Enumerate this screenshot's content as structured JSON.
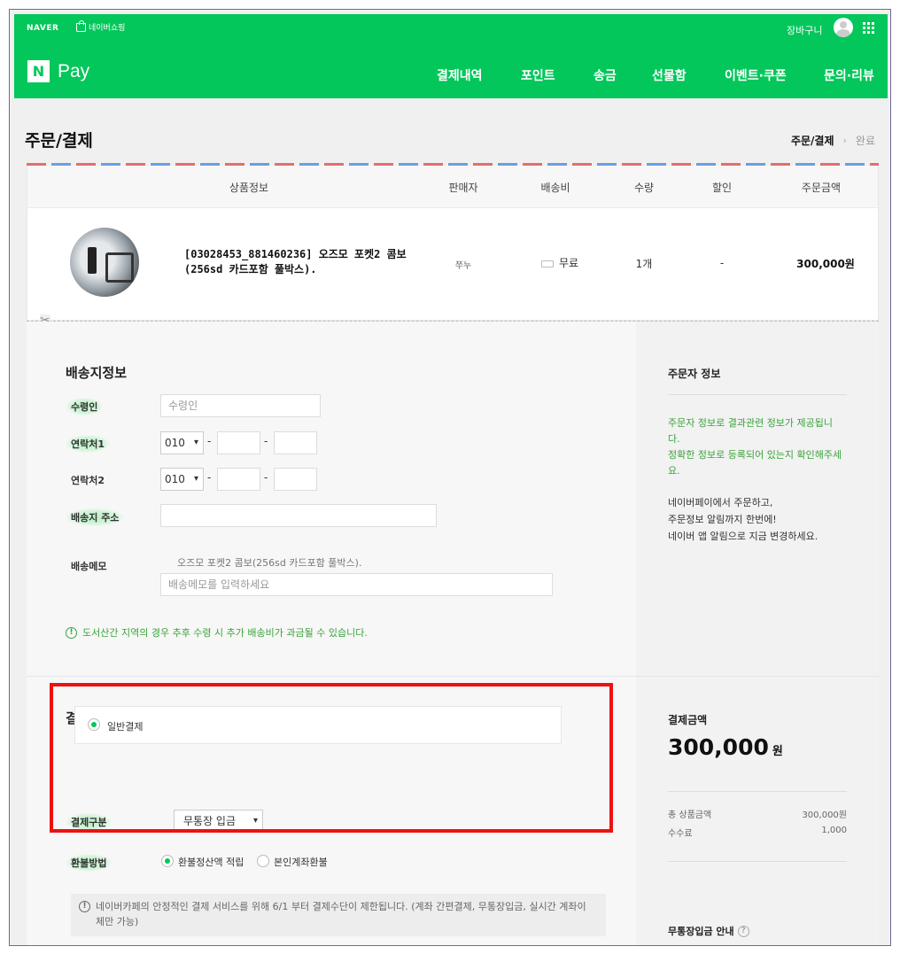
{
  "header": {
    "naver_logo": "NAVER",
    "shopping_link": "네이버쇼핑",
    "cart_link": "장바구니",
    "pay_n": "N",
    "pay_text": "Pay",
    "menu": [
      "결제내역",
      "포인트",
      "송금",
      "선물함",
      "이벤트·쿠폰",
      "문의·리뷰"
    ]
  },
  "page": {
    "title": "주문/결제",
    "step_current": "주문/결제",
    "step_arrow": "›",
    "step_next": "완료"
  },
  "order_table": {
    "columns": [
      "상품정보",
      "판매자",
      "배송비",
      "수량",
      "할인",
      "주문금액"
    ],
    "row": {
      "product_line1": "[03028453_881460236] 오즈모 포켓2 콤보",
      "product_line2": "(256sd 카드포함 풀박스).",
      "seller": "쭈누",
      "shipping": "무료",
      "quantity": "1개",
      "discount": "-",
      "amount": "300,000원"
    }
  },
  "delivery": {
    "title": "배송지정보",
    "recipient_label": "수령인",
    "recipient_placeholder": "수령인",
    "phone1_label": "연락처1",
    "phone2_label": "연락처2",
    "phone_prefix": "010",
    "dash": "-",
    "address_label": "배송지 주소",
    "memo_label": "배송메모",
    "memo_product": "오즈모 포켓2 콤보(256sd 카드포함 풀박스).",
    "memo_placeholder": "배송메모를 입력하세요",
    "notice": "도서산간 지역의 경우 추후 수령 시 추가 배송비가 과금될 수 있습니다."
  },
  "orderer": {
    "title": "주문자 정보",
    "green_line1": "주문자 정보로 결과관련 정보가 제공됩니",
    "green_line2": "다.",
    "green_line3": "정확한 정보로 등록되어 있는지 확인해주세",
    "green_line4": "요.",
    "text_line1": "네이버페이에서 주문하고,",
    "text_line2": "주문정보 알림까지 한번에!",
    "text_line3": "네이버 앱 알림으로 지금 변경하세요."
  },
  "payment": {
    "title": "결제정보",
    "general_payment": "일반결제",
    "method_label": "결제구분",
    "method_value": "무통장 입금",
    "refund_label": "환불방법",
    "refund_opt1": "환불정산액 적립",
    "refund_opt2": "본인계좌환불",
    "info_line1": "네이버카페의 안정적인 결제 서비스를 위해 6/1 부터 결제수단이 제한됩니다. (계좌 간편결제, 무통장입금, 실시간 계좌이",
    "info_line2": "체만 가능)"
  },
  "summary": {
    "title": "결제금액",
    "total": "300,000",
    "won": "원",
    "item_label": "총 상품금액",
    "item_value": "300,000원",
    "fee_label": "수수료",
    "fee_value": "1,000",
    "guide": "무통장입금 안내",
    "guide_q": "?"
  },
  "colors": {
    "brand": "#03c75a",
    "highlight": "#ee1111"
  }
}
